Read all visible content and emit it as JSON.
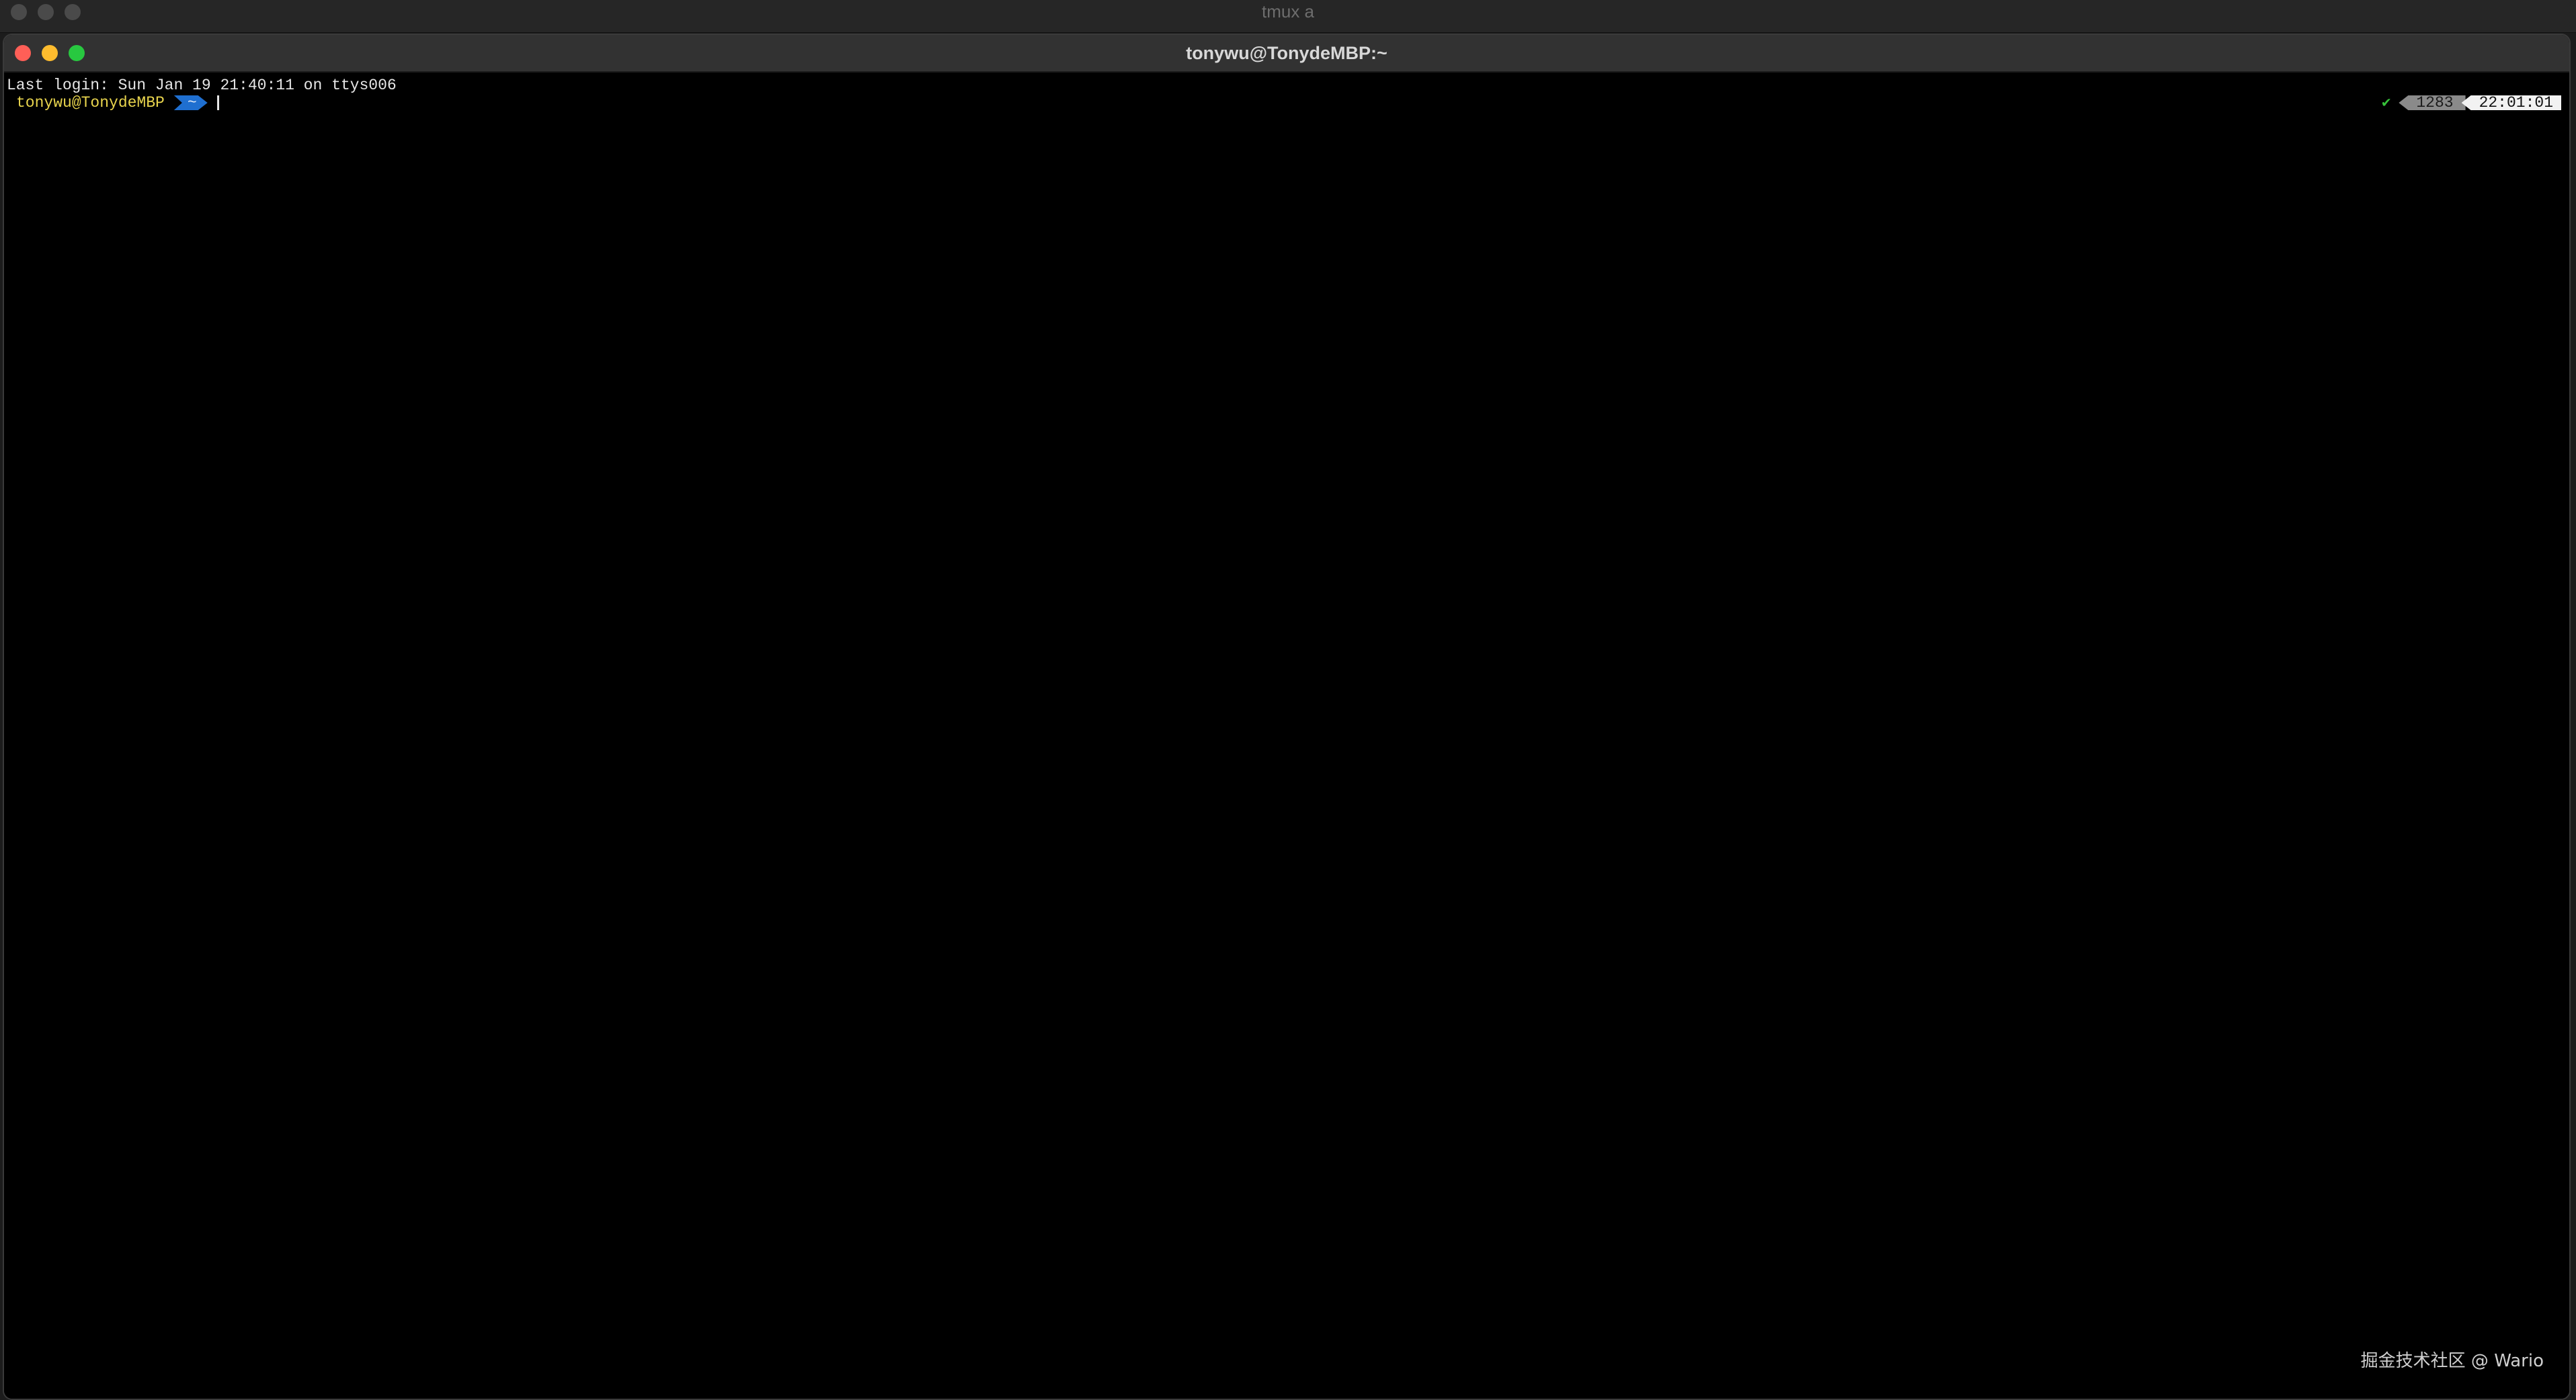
{
  "outer_window": {
    "title": "tmux a"
  },
  "window": {
    "title": "tonywu@TonydeMBP:~"
  },
  "terminal": {
    "last_login": "Last login: Sun Jan 19 21:40:11 on ttys006",
    "prompt_user": "tonywu@TonydeMBP",
    "prompt_dir": "~",
    "status_check": "✔",
    "history_count": "1283",
    "clock": "22:01:01"
  },
  "watermark": "掘金技术社区 @ Wario",
  "colors": {
    "prompt_user": "#e8d44d",
    "prompt_dir_bg": "#1f6fd0",
    "check": "#37c33a",
    "close": "#ff5f57",
    "minimize": "#febc2e",
    "maximize": "#28c840"
  }
}
